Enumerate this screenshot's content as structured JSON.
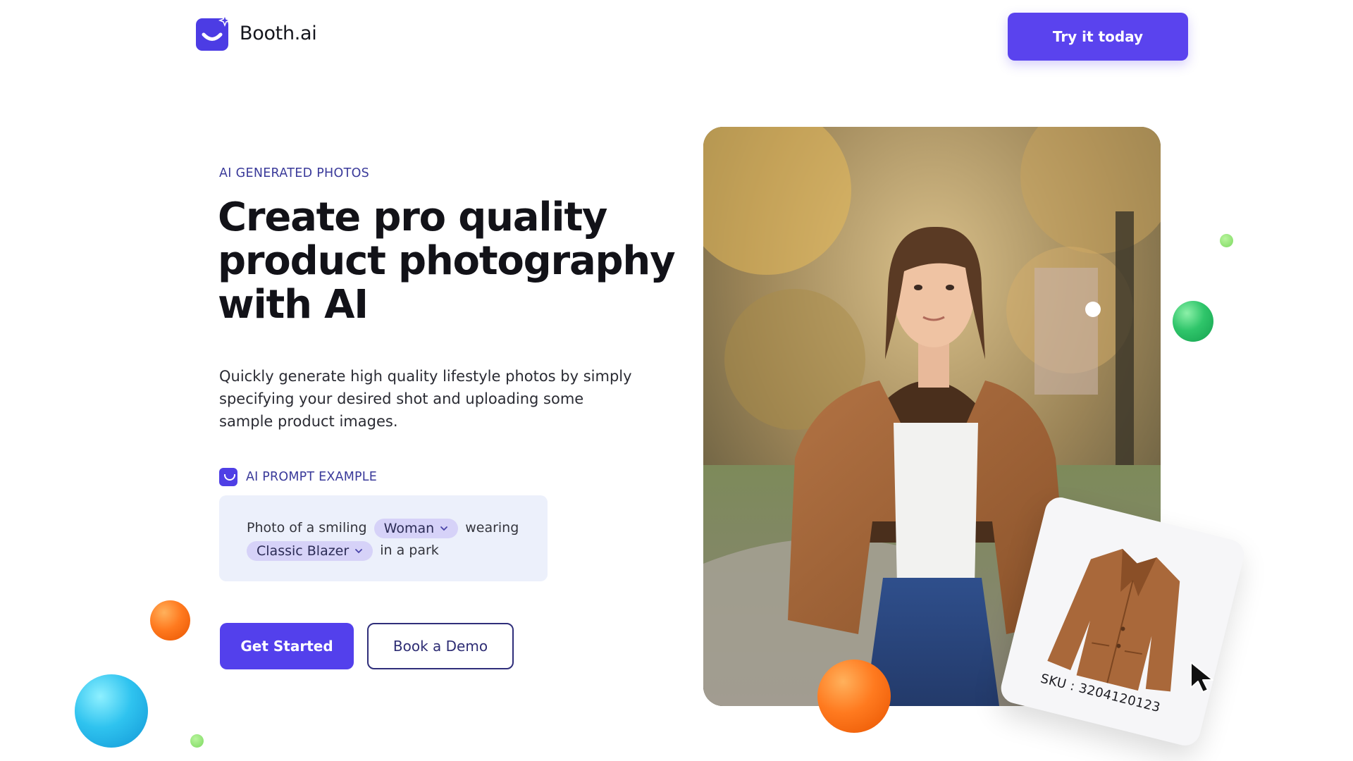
{
  "header": {
    "brand_name": "Booth.ai",
    "cta_label": "Try it today"
  },
  "hero": {
    "eyebrow": "AI GENERATED PHOTOS",
    "headline_line1": "Create pro quality",
    "headline_line2": "product photography",
    "headline_line3": "with AI",
    "subtext": "Quickly generate high quality lifestyle photos by simply specifying your desired shot and uploading some sample product images."
  },
  "prompt": {
    "label": "AI PROMPT EXAMPLE",
    "text_1": "Photo of a smiling",
    "chip_1": "Woman",
    "text_2": "wearing",
    "chip_2": "Classic Blazer",
    "text_3": "in a park"
  },
  "buttons": {
    "primary": "Get Started",
    "secondary": "Book a Demo"
  },
  "product_card": {
    "sku": "SKU : 3204120123"
  },
  "colors": {
    "brand": "#5a43ee",
    "eyebrow": "#3a3a9a",
    "chip_bg": "#d6d2f8",
    "prompt_bg": "#ecf0fb"
  },
  "icons": [
    "booth-logo-icon",
    "prompt-logo-icon",
    "chevron-down-icon",
    "cursor-arrow-icon"
  ]
}
